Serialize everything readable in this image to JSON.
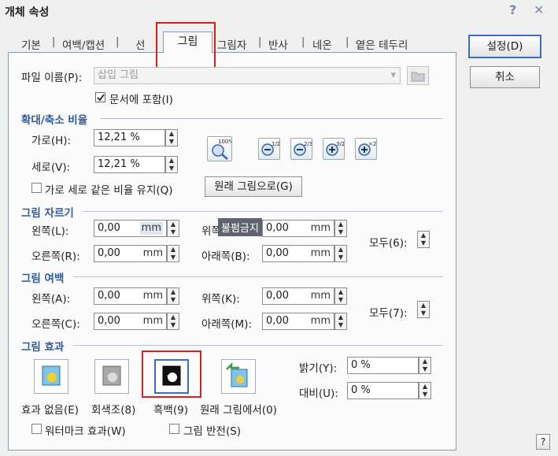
{
  "window": {
    "title": "개체 속성",
    "help_glyph": "?",
    "close_glyph": "✕"
  },
  "tabs": [
    {
      "label": "기본"
    },
    {
      "label": "여백/캡션"
    },
    {
      "label": "선"
    },
    {
      "label": "그림"
    },
    {
      "label": "그림자"
    },
    {
      "label": "반사"
    },
    {
      "label": "네온"
    },
    {
      "label": "옅은 테두리"
    }
  ],
  "tab_sep": "|",
  "buttons": {
    "ok": "설정(D)",
    "cancel": "취소",
    "help": "?"
  },
  "file": {
    "label": "파일 이름(P):",
    "value": "삽입 그림",
    "include_label": "문서에 포함(I)",
    "include_checked": true
  },
  "scale": {
    "title": "확대/축소 비율",
    "horiz_label": "가로(H):",
    "horiz_value": "12,21 %",
    "vert_label": "세로(V):",
    "vert_value": "12,21 %",
    "keep_ratio_label": "가로 세로 같은 비율 유지(Q)",
    "original_button": "원래 그림으로(G)",
    "zoom_icons": [
      {
        "label": "100%"
      },
      {
        "label": "1/2"
      },
      {
        "label": "2/3"
      },
      {
        "label": "3/2"
      },
      {
        "label": "×2"
      }
    ]
  },
  "crop": {
    "title": "그림 자르기",
    "left_label": "왼쪽(L):",
    "left_value": "0,00",
    "left_unit": "mm",
    "top_label": "위쪽(",
    "top_value": "0,00",
    "top_unit": "mm",
    "right_label": "오른쪽(R):",
    "right_value": "0,00",
    "right_unit": "mm",
    "bottom_label": "아래쪽(B):",
    "bottom_value": "0,00",
    "bottom_unit": "mm",
    "all_label": "모두(6):",
    "watermark": "불펌금지"
  },
  "margin": {
    "title": "그림 여백",
    "left_label": "왼쪽(A):",
    "left_value": "0,00",
    "left_unit": "mm",
    "top_label": "위쪽(K):",
    "top_value": "0,00",
    "top_unit": "mm",
    "right_label": "오른쪽(C):",
    "right_value": "0,00",
    "right_unit": "mm",
    "bottom_label": "아래쪽(M):",
    "bottom_value": "0,00",
    "bottom_unit": "mm",
    "all_label": "모두(7):"
  },
  "effect": {
    "title": "그림 효과",
    "none_label": "효과 없음(E)",
    "gray_label": "회색조(8)",
    "bw_label": "흑백(9)",
    "orig_label": "원래 그림에서(0)",
    "brightness_label": "밝기(Y):",
    "brightness_value": "0 %",
    "contrast_label": "대비(U):",
    "contrast_value": "0 %",
    "watermark_label": "워터마크 효과(W)",
    "invert_label": "그림 반전(S)"
  },
  "spin_up": "▲",
  "spin_down": "▼",
  "dropdown_glyph": "▾"
}
